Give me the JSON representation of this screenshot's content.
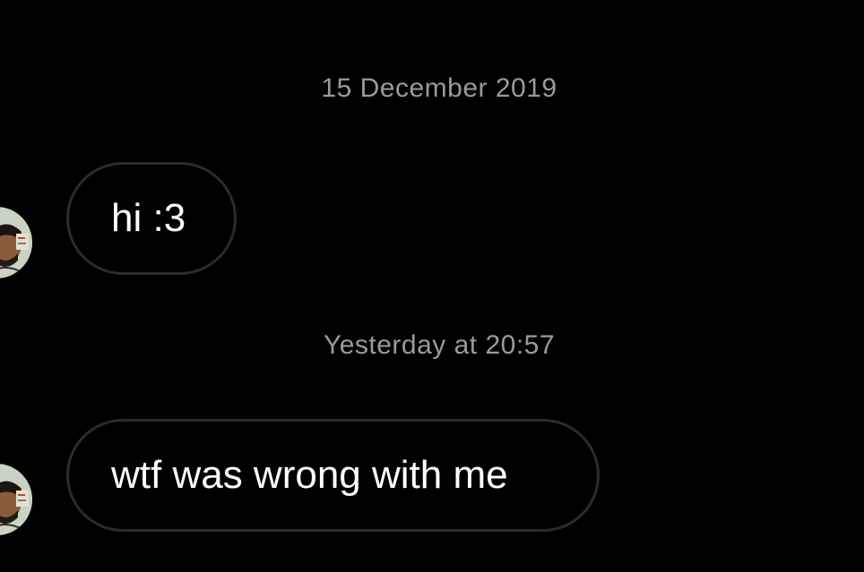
{
  "conversation": {
    "messages": [
      {
        "timestamp": "15 December 2019",
        "text": "hi :3"
      },
      {
        "timestamp": "Yesterday at 20:57",
        "text": "wtf was wrong with me"
      }
    ]
  },
  "icons": {
    "avatar": "user-avatar-photo"
  },
  "colors": {
    "background": "#000000",
    "timestamp_text": "#9a9a9a",
    "bubble_border": "#2b2b2b",
    "message_text": "#ffffff"
  }
}
